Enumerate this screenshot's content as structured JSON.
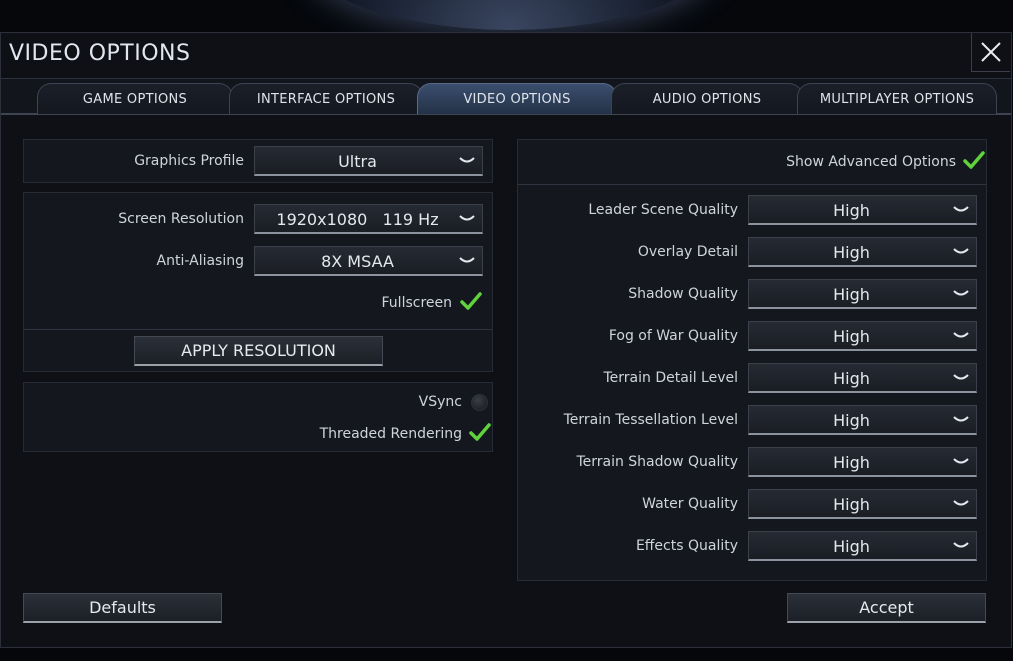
{
  "window": {
    "title": "VIDEO OPTIONS"
  },
  "tabs": [
    {
      "label": "GAME OPTIONS",
      "active": false
    },
    {
      "label": "INTERFACE OPTIONS",
      "active": false
    },
    {
      "label": "VIDEO OPTIONS",
      "active": true
    },
    {
      "label": "AUDIO OPTIONS",
      "active": false
    },
    {
      "label": "MULTIPLAYER OPTIONS",
      "active": false
    }
  ],
  "left": {
    "graphics_profile": {
      "label": "Graphics Profile",
      "value": "Ultra"
    },
    "screen_resolution": {
      "label": "Screen Resolution",
      "value": "1920x1080   119 Hz"
    },
    "anti_aliasing": {
      "label": "Anti-Aliasing",
      "value": "8X MSAA"
    },
    "fullscreen": {
      "label": "Fullscreen",
      "checked": true
    },
    "apply_resolution": "APPLY RESOLUTION",
    "vsync": {
      "label": "VSync",
      "checked": false
    },
    "threaded_rendering": {
      "label": "Threaded Rendering",
      "checked": true
    }
  },
  "right": {
    "show_advanced": {
      "label": "Show Advanced Options",
      "checked": true
    },
    "settings": [
      {
        "label": "Leader Scene Quality",
        "value": "High"
      },
      {
        "label": "Overlay Detail",
        "value": "High"
      },
      {
        "label": "Shadow Quality",
        "value": "High"
      },
      {
        "label": "Fog of War Quality",
        "value": "High"
      },
      {
        "label": "Terrain Detail Level",
        "value": "High"
      },
      {
        "label": "Terrain Tessellation Level",
        "value": "High"
      },
      {
        "label": "Terrain Shadow Quality",
        "value": "High"
      },
      {
        "label": "Water Quality",
        "value": "High"
      },
      {
        "label": "Effects Quality",
        "value": "High"
      }
    ]
  },
  "footer": {
    "defaults": "Defaults",
    "accept": "Accept"
  },
  "colors": {
    "check": "#5fd23c",
    "tab_active": "#3a4e6e",
    "panel": "#14171e"
  }
}
